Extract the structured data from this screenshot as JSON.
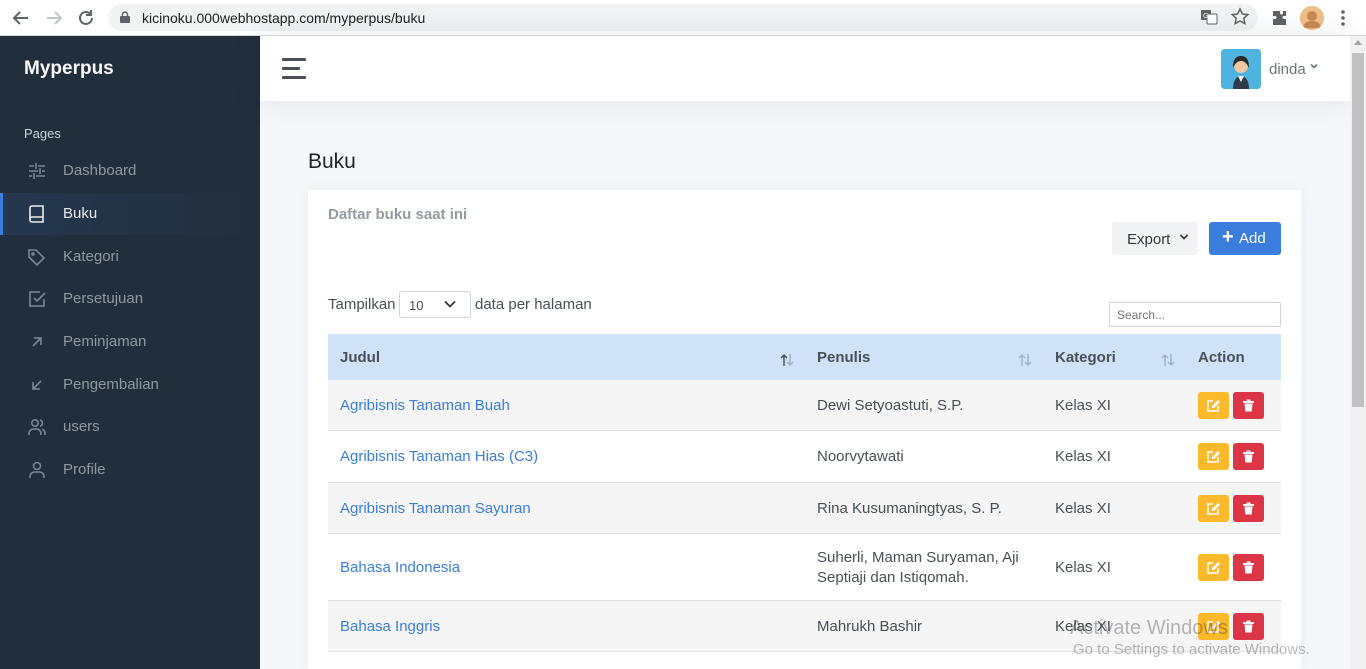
{
  "browser": {
    "url": "kicinoku.000webhostapp.com/myperpus/buku"
  },
  "sidebar": {
    "brand": "Myperpus",
    "section": "Pages",
    "items": [
      {
        "label": "Dashboard",
        "icon": "sliders-icon"
      },
      {
        "label": "Buku",
        "icon": "book-icon",
        "active": true
      },
      {
        "label": "Kategori",
        "icon": "tag-icon"
      },
      {
        "label": "Persetujuan",
        "icon": "check-square-icon"
      },
      {
        "label": "Peminjaman",
        "icon": "arrow-up-right-icon"
      },
      {
        "label": "Pengembalian",
        "icon": "arrow-down-left-icon"
      },
      {
        "label": "users",
        "icon": "users-icon"
      },
      {
        "label": "Profile",
        "icon": "user-icon"
      }
    ]
  },
  "topbar": {
    "user_name": "dinda"
  },
  "page": {
    "title": "Buku",
    "card_subtitle": "Daftar buku saat ini",
    "export_label": "Export",
    "add_label": "Add",
    "length_prefix": "Tampilkan",
    "length_value": "10",
    "length_suffix": "data per halaman",
    "search_placeholder": "Search..."
  },
  "table": {
    "headers": {
      "judul": "Judul",
      "penulis": "Penulis",
      "kategori": "Kategori",
      "action": "Action"
    },
    "rows": [
      {
        "judul": "Agribisnis Tanaman Buah",
        "penulis": "Dewi Setyoastuti, S.P.",
        "penulis2": "",
        "kategori": "Kelas XI"
      },
      {
        "judul": "Agribisnis Tanaman Hias (C3)",
        "penulis": "Noorvytawati",
        "penulis2": "",
        "kategori": "Kelas XI"
      },
      {
        "judul": "Agribisnis Tanaman Sayuran",
        "penulis": "Rina Kusumaningtyas, S. P.",
        "penulis2": "",
        "kategori": "Kelas XI"
      },
      {
        "judul": "Bahasa Indonesia",
        "penulis": "Suherli, Maman Suryaman, Aji",
        "penulis2": "Septiaji dan Istiqomah.",
        "kategori": "Kelas XI"
      },
      {
        "judul": "Bahasa Inggris",
        "penulis": "Mahrukh Bashir",
        "penulis2": "",
        "kategori": "Kelas XI"
      }
    ]
  },
  "watermark": {
    "line1": "Activate Windows",
    "line2": "Go to Settings to activate Windows."
  },
  "colors": {
    "sidebar_bg": "#222e3c",
    "primary": "#3b7ddd",
    "warning": "#fcb92c",
    "danger": "#dc3545",
    "table_header": "#cfe2f7"
  }
}
